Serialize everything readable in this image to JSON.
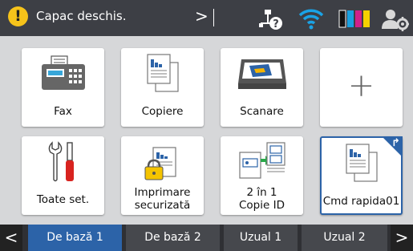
{
  "status": {
    "warning_glyph": "!",
    "message": "Capac deschis.",
    "arrow": ">",
    "icons": [
      "network-help-icon",
      "wifi-icon",
      "ink-level-icon",
      "admin-settings-icon"
    ],
    "ink_colors": [
      "#111111",
      "#1aa0e0",
      "#d0208a",
      "#f5d000"
    ]
  },
  "tiles": {
    "fax": {
      "label": "Fax"
    },
    "copy": {
      "label": "Copiere"
    },
    "scan": {
      "label": "Scanare"
    },
    "add": {
      "label": "+"
    },
    "all_settings": {
      "label": "Toate set."
    },
    "secure_print": {
      "line1": "Imprimare",
      "line2": "securizată"
    },
    "id_copy": {
      "line1": "2 în 1",
      "line2": "Copie ID"
    },
    "shortcut": {
      "label": "Cmd rapida01"
    }
  },
  "tabs": {
    "prev": "<",
    "next": ">",
    "items": [
      {
        "label": "De bază 1",
        "active": true
      },
      {
        "label": "De bază 2",
        "active": false
      },
      {
        "label": "Uzual 1",
        "active": false
      },
      {
        "label": "Uzual 2",
        "active": false
      }
    ]
  },
  "colors": {
    "accent": "#2c63a8",
    "warning": "#f6c31a",
    "status_bar": "#3d3f45",
    "background": "#d6d7d9"
  }
}
